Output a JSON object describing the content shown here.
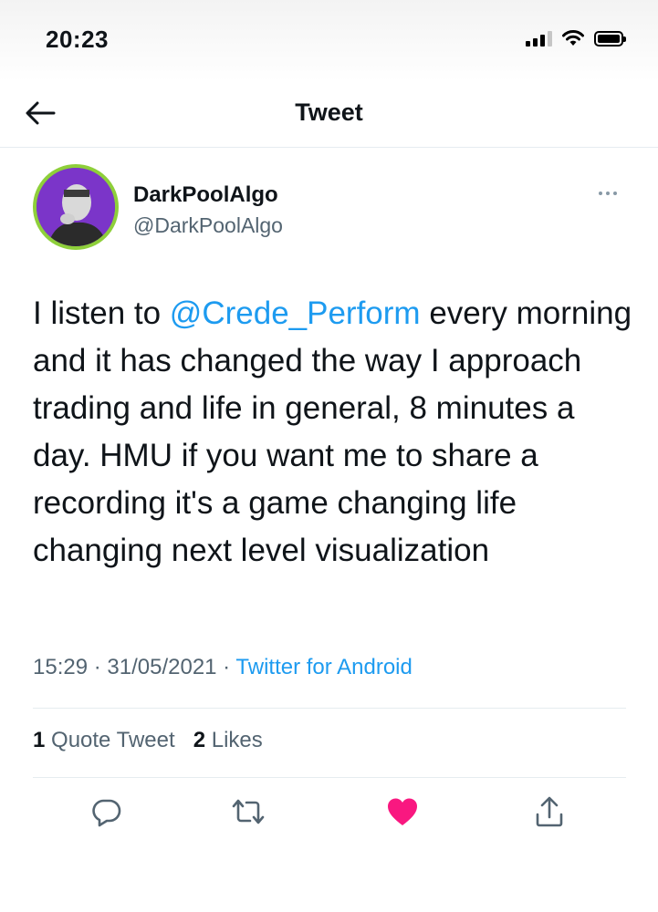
{
  "status_bar": {
    "time": "20:23",
    "signal_icon": "cellular-signal-icon",
    "wifi_icon": "wifi-icon",
    "battery_icon": "battery-icon"
  },
  "header": {
    "title": "Tweet",
    "back_icon": "arrow-left-icon"
  },
  "author": {
    "display_name": "DarkPoolAlgo",
    "handle": "@DarkPoolAlgo",
    "more_icon": "more-horizontal-icon"
  },
  "tweet": {
    "text_before": "I listen to ",
    "mention": "@Crede_Perform",
    "text_after": " every morning and it has changed the way I approach trading and life in general, 8 minutes a day. HMU if you want me to share a recording it's a game changing life changing next level visualization"
  },
  "meta": {
    "time": "15:29",
    "separator": " · ",
    "date": "31/05/2021",
    "source": "Twitter for Android"
  },
  "stats": {
    "quote_count": "1",
    "quote_label": " Quote Tweet",
    "likes_count": "2",
    "likes_label": " Likes"
  },
  "actions": {
    "reply_icon": "reply-icon",
    "retweet_icon": "retweet-icon",
    "like_icon": "heart-filled-icon",
    "share_icon": "share-icon",
    "like_color": "#f91880",
    "icon_color": "#536471",
    "link_color": "#1d9bf0"
  }
}
